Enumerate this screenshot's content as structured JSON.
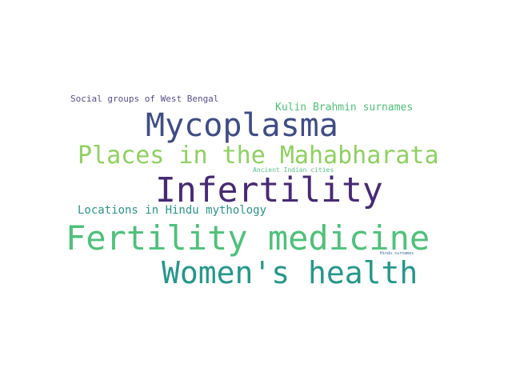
{
  "words": [
    {
      "text": "Social groups of West Bengal",
      "color": "#5b4e8a"
    },
    {
      "text": "Kulin Brahmin surnames",
      "color": "#4fbf78"
    },
    {
      "text": "Mycoplasma",
      "color": "#3f4d85"
    },
    {
      "text": "Places in the Mahabharata",
      "color": "#8ed160"
    },
    {
      "text": "Ancient Indian cities",
      "color": "#5ac08c"
    },
    {
      "text": "Infertility",
      "color": "#472a75"
    },
    {
      "text": "Locations in Hindu mythology",
      "color": "#2b968a"
    },
    {
      "text": "Fertility medicine",
      "color": "#4fc17a"
    },
    {
      "text": "Hindu surnames",
      "color": "#3e6c9a"
    },
    {
      "text": "Women's health",
      "color": "#25978b"
    }
  ]
}
